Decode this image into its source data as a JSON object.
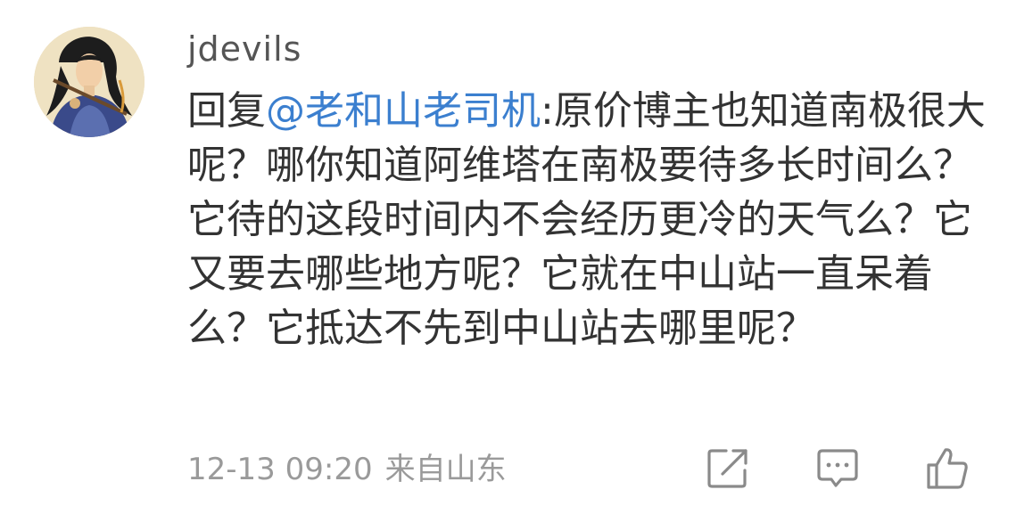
{
  "comment": {
    "username": "jdevils",
    "reply_prefix": "回复",
    "mention": "@老和山老司机",
    "reply_text": ":原价博主也知道南极很大呢？哪你知道阿维塔在南极要待多长时间么？它待的这段时间内不会经历更冷的天气么？它又要去哪些地方呢？它就在中山站一直呆着么？它抵达不先到中山站去哪里呢？",
    "date": "12-13 09:20",
    "location": "来自山东"
  },
  "actions": {
    "share_icon": "share-icon",
    "reply_icon": "comment-icon",
    "like_icon": "thumbs-up-icon"
  },
  "colors": {
    "mention": "#3b7fcf",
    "text": "#333333",
    "username": "#555555",
    "meta": "#9a9a9a",
    "icon": "#8a8a8a"
  }
}
